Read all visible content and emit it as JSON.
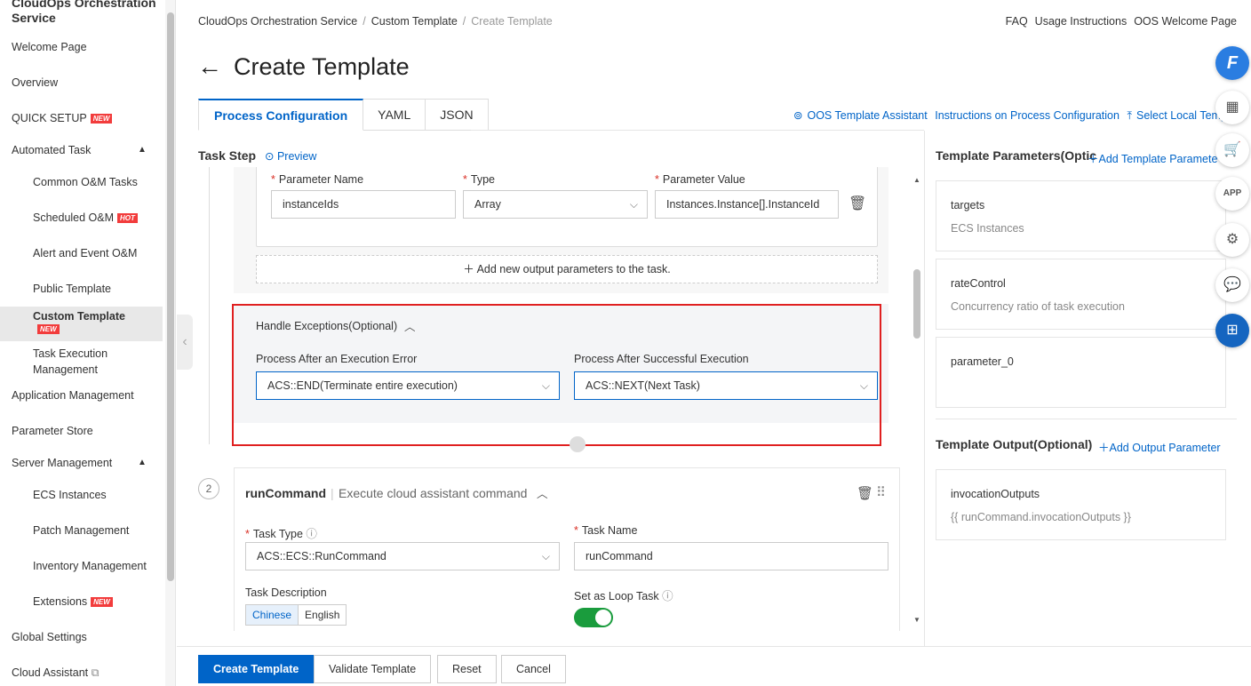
{
  "sidebar": {
    "brand": "CloudOps Orchestration Service",
    "items": [
      {
        "label": "Welcome Page"
      },
      {
        "label": "Overview"
      },
      {
        "label": "QUICK SETUP",
        "badge": "NEW"
      },
      {
        "label": "Automated Task"
      },
      {
        "label": "Common O&M Tasks"
      },
      {
        "label": "Scheduled O&M",
        "badge": "HOT"
      },
      {
        "label": "Alert and Event O&M"
      },
      {
        "label": "Public Template"
      },
      {
        "label": "Custom Template",
        "badge": "NEW"
      },
      {
        "label": "Task Execution Management"
      },
      {
        "label": "Application Management"
      },
      {
        "label": "Parameter Store"
      },
      {
        "label": "Server Management"
      },
      {
        "label": "ECS Instances"
      },
      {
        "label": "Patch Management"
      },
      {
        "label": "Inventory Management"
      },
      {
        "label": "Extensions",
        "badge": "NEW"
      },
      {
        "label": "Global Settings"
      },
      {
        "label": "Cloud Assistant"
      }
    ]
  },
  "breadcrumb": [
    "CloudOps Orchestration Service",
    "Custom Template",
    "Create Template"
  ],
  "toplinks": [
    "FAQ",
    "Usage Instructions",
    "OOS Welcome Page"
  ],
  "page_title": "Create Template",
  "tabs": [
    "Process Configuration",
    "YAML",
    "JSON"
  ],
  "toolbar": {
    "assistant": "OOS Template Assistant",
    "instructions": "Instructions on Process Configuration",
    "select_local": "Select Local Templ"
  },
  "task_step": {
    "label": "Task Step",
    "preview": "Preview"
  },
  "output_param": {
    "name_label": "Parameter Name",
    "type_label": "Type",
    "value_label": "Parameter Value",
    "name_value": "instanceIds",
    "type_value": "Array",
    "value_value": "Instances.Instance[].InstanceId",
    "add_label": "Add new output parameters to the task."
  },
  "exceptions": {
    "title": "Handle Exceptions(Optional)",
    "error_label": "Process After an Execution Error",
    "error_value": "ACS::END(Terminate entire execution)",
    "success_label": "Process After Successful Execution",
    "success_value": "ACS::NEXT(Next Task)"
  },
  "task2": {
    "number": "2",
    "name": "runCommand",
    "description": "Execute cloud assistant command",
    "task_type_label": "Task Type",
    "task_type_value": "ACS::ECS::RunCommand",
    "task_name_label": "Task Name",
    "task_name_value": "runCommand",
    "task_desc_label": "Task Description",
    "lang_options": [
      "Chinese",
      "English"
    ],
    "loop_label": "Set as Loop Task"
  },
  "right": {
    "params_title": "Template Parameters(Optic",
    "add_param": "Add Template Paramete",
    "params": [
      {
        "name": "targets",
        "desc": "ECS Instances"
      },
      {
        "name": "rateControl",
        "desc": "Concurrency ratio of task execution"
      },
      {
        "name": "parameter_0",
        "desc": ""
      }
    ],
    "output_title": "Template Output(Optional)",
    "add_output": "Add Output Parameter",
    "outputs": [
      {
        "name": "invocationOutputs",
        "desc": "{{ runCommand.invocationOutputs }}"
      }
    ]
  },
  "footer": {
    "create": "Create Template",
    "validate": "Validate Template",
    "reset": "Reset",
    "cancel": "Cancel"
  },
  "colors": {
    "primary": "#0064c8",
    "highlight": "#e02020",
    "toggle_on": "#1a9c3d"
  }
}
